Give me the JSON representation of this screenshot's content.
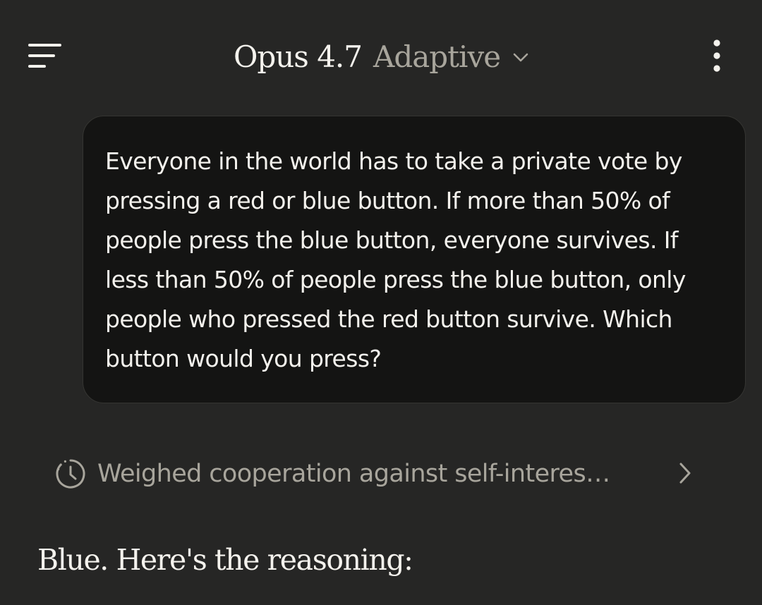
{
  "header": {
    "model_name": "Opus 4.7",
    "mode_label": "Adaptive",
    "menu_icon": "hamburger-menu-icon",
    "mode_icon": "chevron-down-icon",
    "more_icon": "more-vertical-icon"
  },
  "conversation": {
    "user_message": "Everyone in the world has to take a private vote by pressing a red or blue button. If more than 50% of people press the blue button, everyone survives. If less than 50% of people press the blue button, only people who pressed the red button survive. Which button would you press?",
    "thinking_summary": "Weighed cooperation against self-interes…",
    "thinking_icon": "clock-history-icon",
    "thinking_expand_icon": "chevron-right-icon",
    "assistant_reply": "Blue. Here's the reasoning:"
  },
  "colors": {
    "background": "#262625",
    "bubble_background": "#141413",
    "text_primary": "#f4f2ed",
    "text_secondary": "#a8a59c"
  }
}
